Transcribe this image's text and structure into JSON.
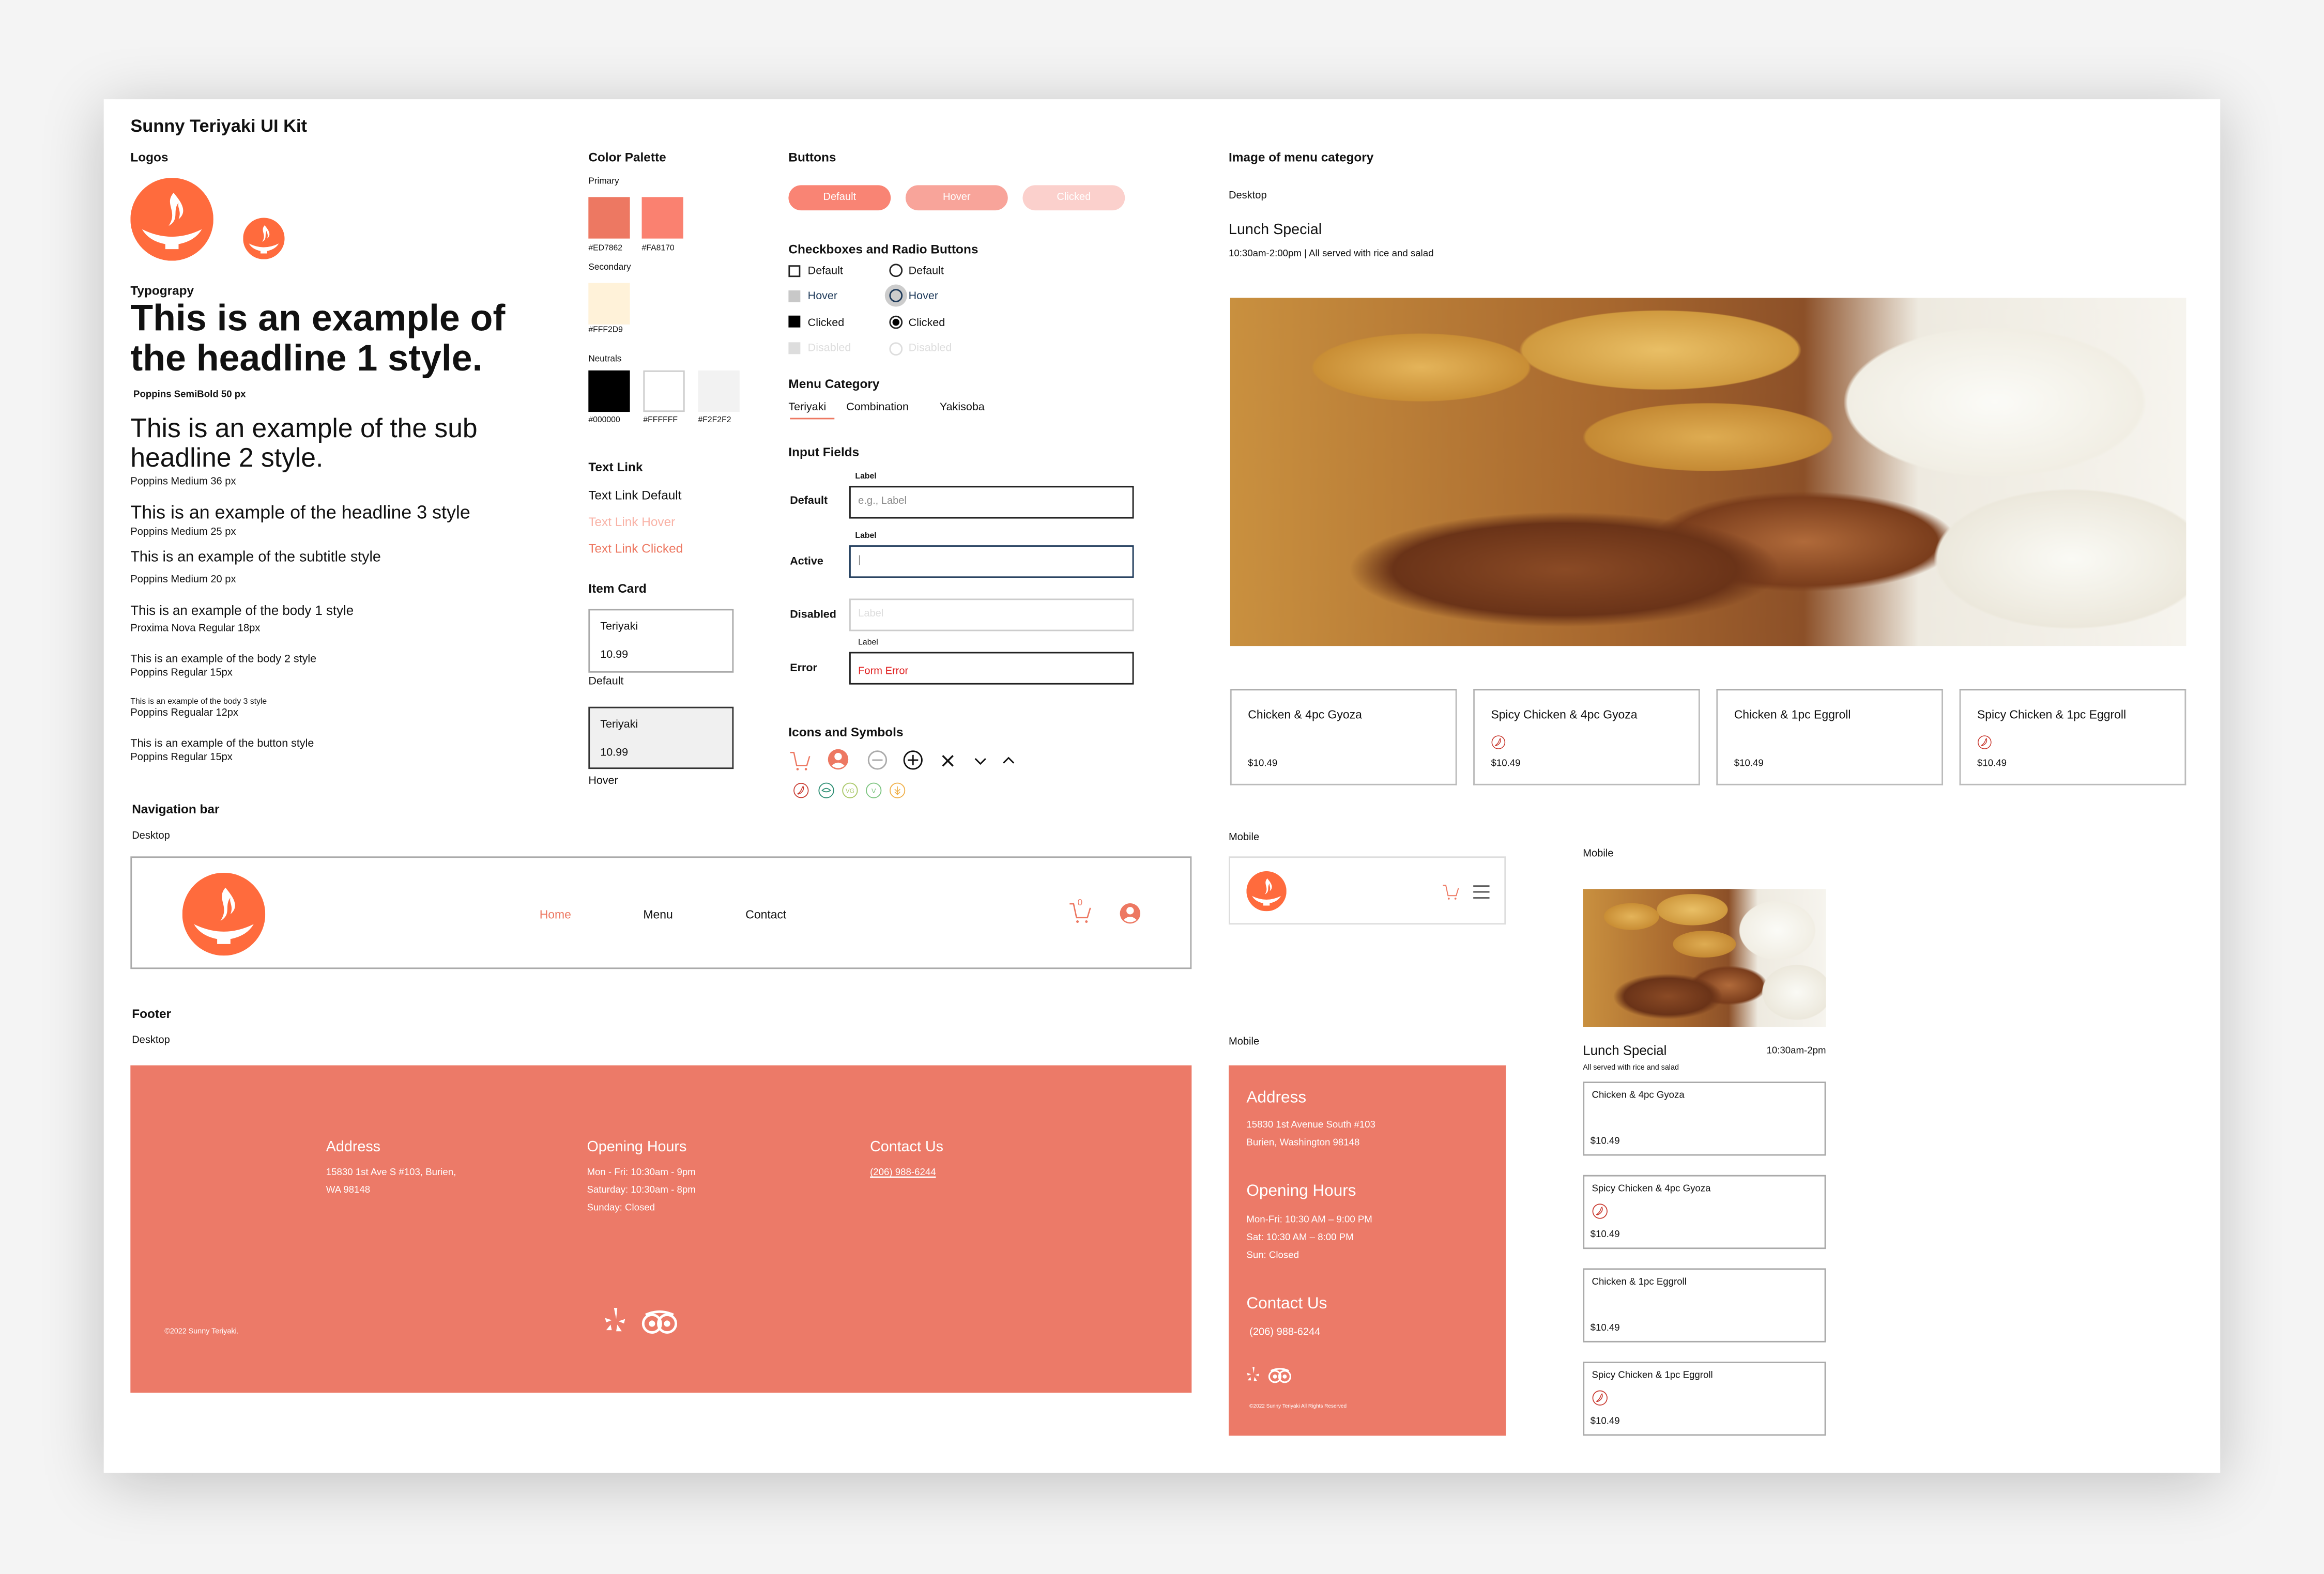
{
  "title": "Sunny Teriyaki UI Kit",
  "logos": {
    "heading": "Logos"
  },
  "typography": {
    "heading": "Typograpy",
    "samples": [
      {
        "text": "This is an example of the headline 1 style.",
        "spec": "Poppins SemiBold 50 px"
      },
      {
        "text": "This is an example of the sub headline 2 style.",
        "spec": "Poppins Medium 36 px"
      },
      {
        "text": "This is an example of the headline 3 style",
        "spec": "Poppins Medium 25 px"
      },
      {
        "text": "This is an example of the subtitle style",
        "spec": "Poppins Medium 20 px"
      },
      {
        "text": "This is an example of the body 1 style",
        "spec": "Proxima Nova Regular 18px"
      },
      {
        "text": "This is an example of the body 2 style",
        "spec": "Poppins Regular 15px"
      },
      {
        "text": "This is an example of the body 3 style",
        "spec": "Poppins Regualar 12px"
      },
      {
        "text": "This is an example of the button style",
        "spec": "Poppins Regular 15px"
      }
    ]
  },
  "palette": {
    "heading": "Color Palette",
    "primary_label": "Primary",
    "primary": [
      "#ED7862",
      "#FA8170"
    ],
    "secondary_label": "Secondary",
    "secondary": [
      "#FFF2D9"
    ],
    "neutrals_label": "Neutrals",
    "neutrals": [
      "#000000",
      "#FFFFFF",
      "#F2F2F2"
    ]
  },
  "text_link": {
    "heading": "Text Link",
    "default": "Text Link Default",
    "hover": "Text Link Hover",
    "clicked": "Text Link Clicked"
  },
  "item_card": {
    "heading": "Item Card",
    "cards": [
      {
        "name": "Teriyaki",
        "price": "10.99",
        "state": "Default"
      },
      {
        "name": "Teriyaki",
        "price": "10.99",
        "state": "Hover"
      }
    ]
  },
  "buttons": {
    "heading": "Buttons",
    "items": [
      "Default",
      "Hover",
      "Clicked"
    ],
    "colors": [
      "#F98474",
      "#F8A49A",
      "#FBD0CC"
    ]
  },
  "checks": {
    "heading": "Checkboxes and Radio Buttons",
    "checkbox": [
      "Default",
      "Hover",
      "Clicked",
      "Disabled"
    ],
    "radio": [
      "Default",
      "Hover",
      "Clicked",
      "Disabled"
    ]
  },
  "menu_category": {
    "heading": "Menu Category",
    "tabs": [
      "Teriyaki",
      "Combination",
      "Yakisoba"
    ],
    "active": "Teriyaki"
  },
  "inputs": {
    "heading": "Input Fields",
    "rows": [
      {
        "state": "Default",
        "label": "Label",
        "placeholder": "e.g., Label"
      },
      {
        "state": "Active",
        "label": "Label",
        "value": "|"
      },
      {
        "state": "Disabled",
        "placeholder": "Label"
      },
      {
        "state": "Error",
        "label": "Label",
        "value": "Form Error"
      }
    ]
  },
  "icons": {
    "heading": "Icons and Symbols",
    "row1": [
      "cart-icon",
      "user-icon",
      "minus-icon",
      "plus-icon",
      "close-icon",
      "chevron-down-icon",
      "chevron-up-icon"
    ],
    "row2": [
      "spicy-icon",
      "vegetarian-leaf-icon",
      "vg-icon",
      "v-icon",
      "gluten-icon"
    ],
    "row2_labels": [
      "VG",
      "V"
    ]
  },
  "menu_image": {
    "heading": "Image of menu category",
    "desktop_label": "Desktop",
    "title": "Lunch Special",
    "subtitle": "10:30am-2:00pm | All served with rice and salad",
    "items": [
      {
        "name": "Chicken & 4pc Gyoza",
        "price": "$10.49",
        "spicy": false
      },
      {
        "name": "Spicy Chicken & 4pc Gyoza",
        "price": "$10.49",
        "spicy": true
      },
      {
        "name": "Chicken & 1pc Eggroll",
        "price": "$10.49",
        "spicy": false
      },
      {
        "name": "Spicy Chicken & 1pc Eggroll",
        "price": "$10.49",
        "spicy": true
      }
    ]
  },
  "mobile_menu": {
    "label": "Mobile",
    "title": "Lunch Special",
    "hours": "10:30am-2pm",
    "subtitle": "All served with rice and salad"
  },
  "nav": {
    "heading": "Navigation bar",
    "desktop_label": "Desktop",
    "mobile_label": "Mobile",
    "links": [
      "Home",
      "Menu",
      "Contact"
    ],
    "active": "Home",
    "cart_count": "0"
  },
  "footer": {
    "heading": "Footer",
    "desktop_label": "Desktop",
    "address_title": "Address",
    "address_lines": [
      "15830 1st Ave S #103, Burien,",
      "WA 98148"
    ],
    "hours_title": "Opening Hours",
    "hours_lines": [
      "Mon - Fri: 10:30am - 9pm",
      "Saturday: 10:30am - 8pm",
      "Sunday: Closed"
    ],
    "contact_title": "Contact Us",
    "phone": "(206) 988-6244",
    "copyright": "©2022 Sunny Teriyaki.",
    "color": "#EC7A68"
  },
  "mobile_footer": {
    "label": "Mobile",
    "address_title": "Address",
    "address_lines": [
      "15830 1st Avenue South #103",
      "Burien, Washington 98148"
    ],
    "hours_title": "Opening Hours",
    "hours_lines": [
      "Mon-Fri: 10:30 AM – 9:00 PM",
      "Sat: 10:30 AM – 8:00 PM",
      "Sun: Closed"
    ],
    "contact_title": "Contact Us",
    "phone": "(206) 988-6244",
    "copyright": "©2022 Sunny Teriyaki All Rights Reserved"
  }
}
